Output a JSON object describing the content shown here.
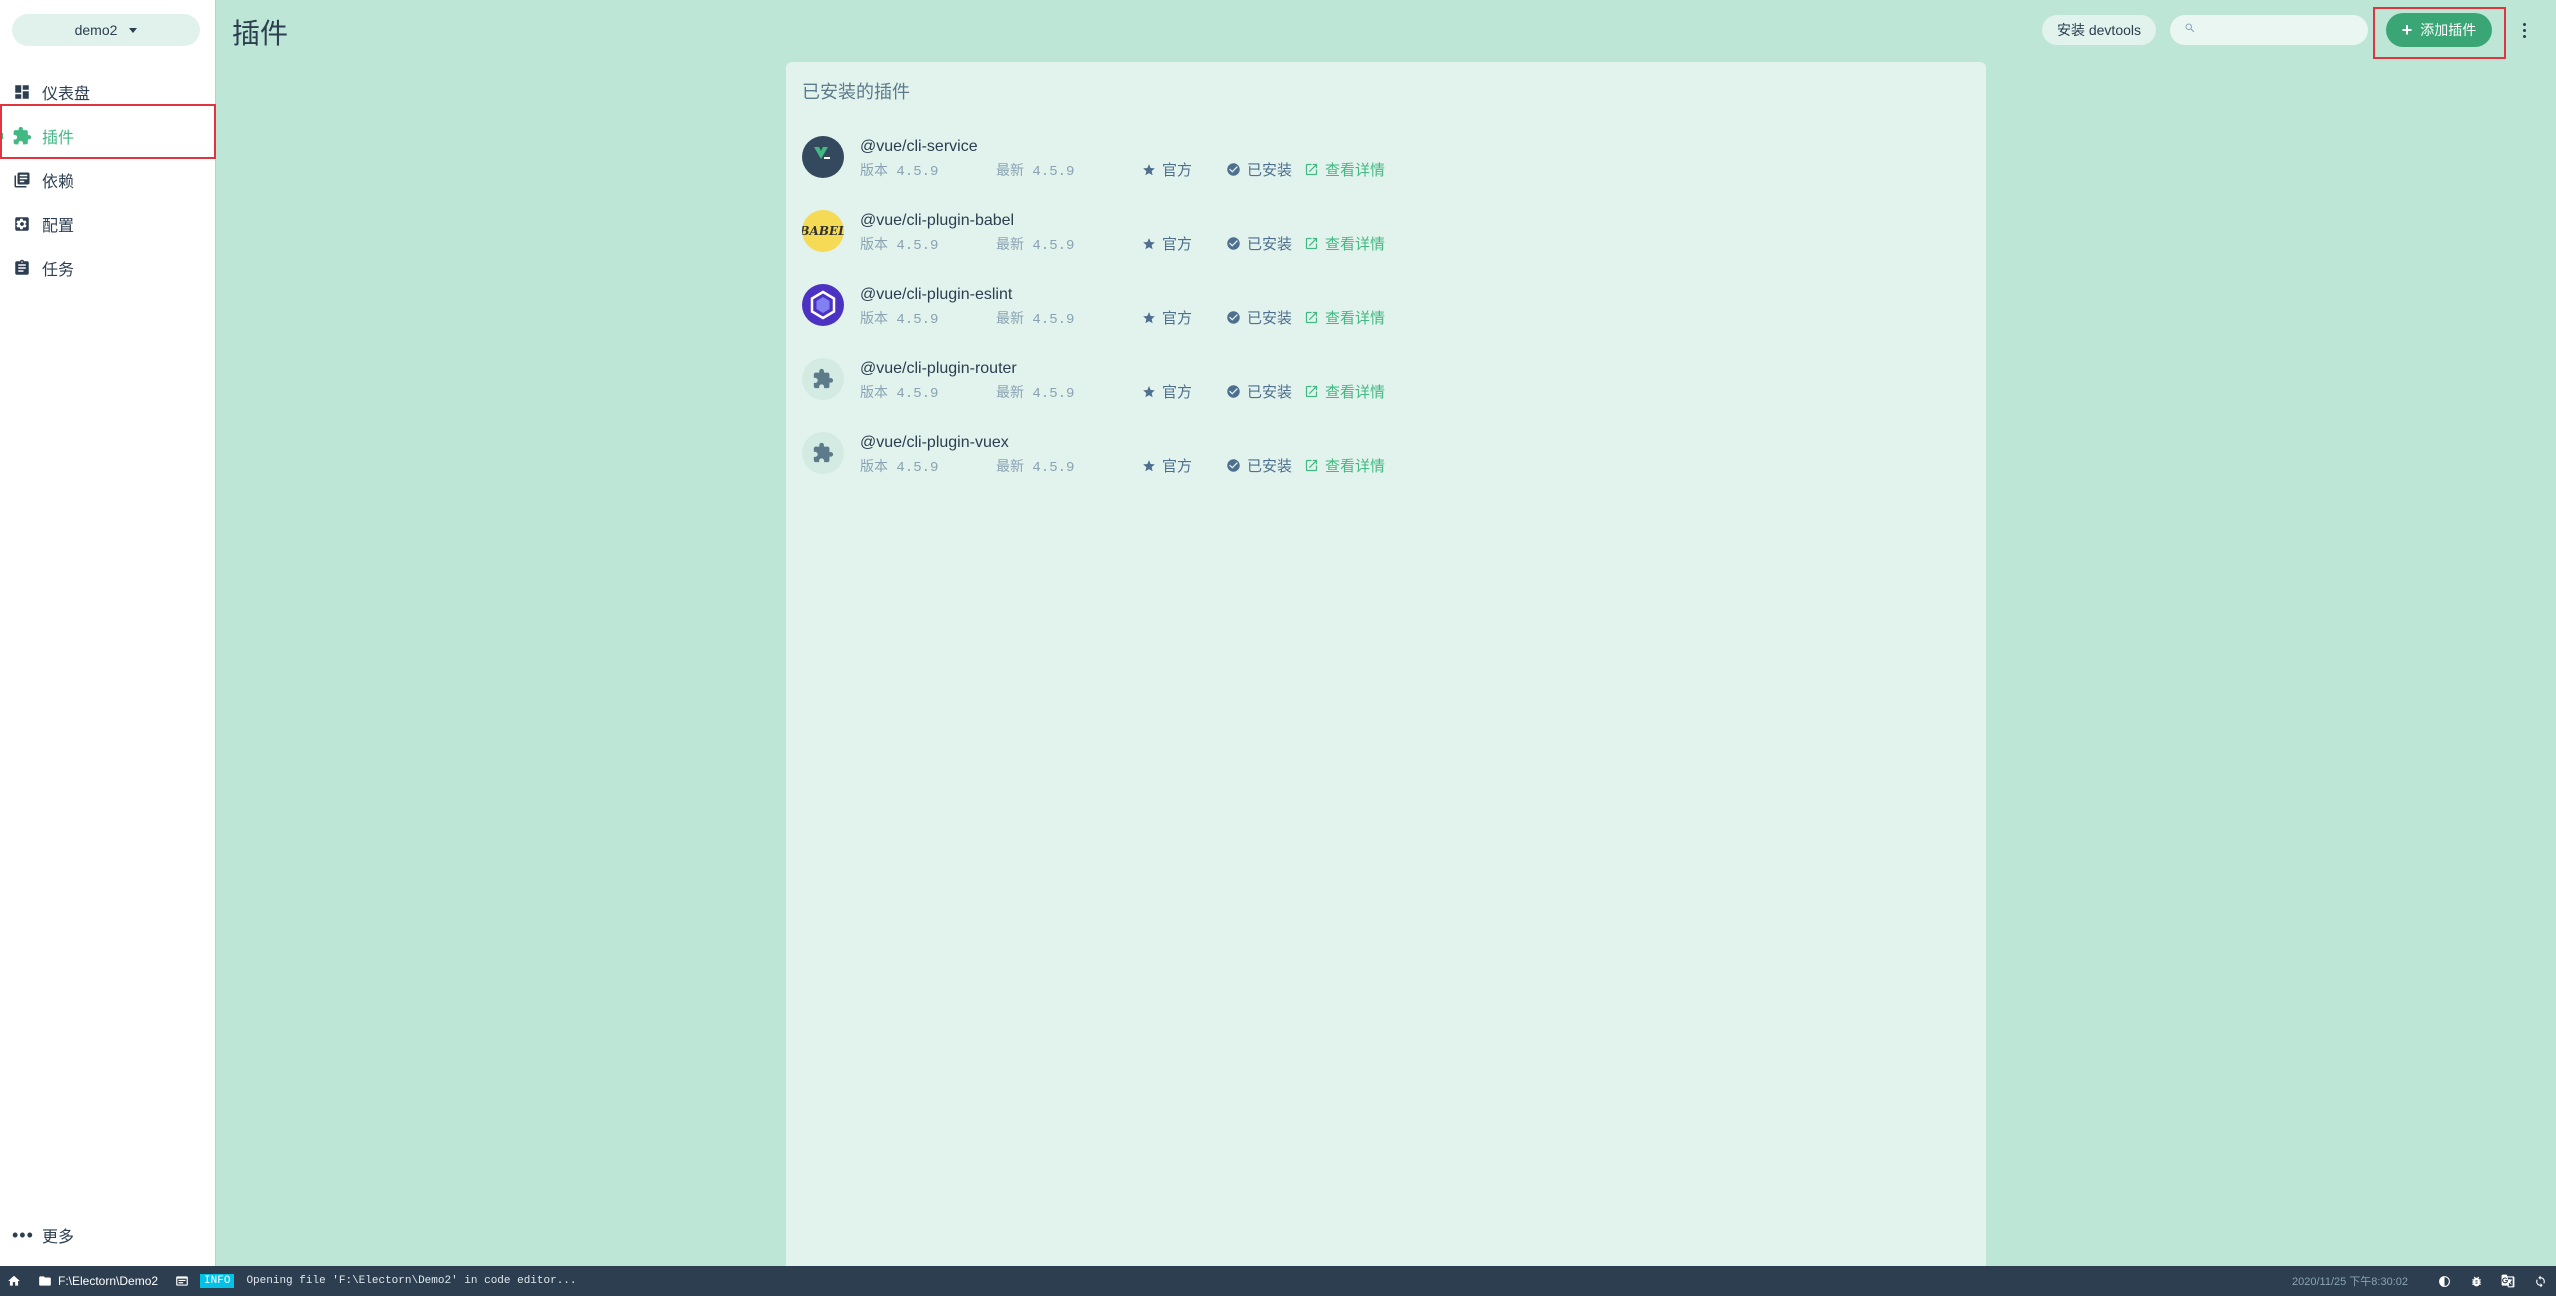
{
  "sidebar": {
    "project": "demo2",
    "items": [
      {
        "label": "仪表盘",
        "icon": "dashboard-icon"
      },
      {
        "label": "插件",
        "icon": "puzzle-icon",
        "active": true
      },
      {
        "label": "依赖",
        "icon": "library-icon"
      },
      {
        "label": "配置",
        "icon": "settings-icon"
      },
      {
        "label": "任务",
        "icon": "clipboard-icon"
      }
    ],
    "more_label": "更多"
  },
  "header": {
    "title": "插件",
    "devtools_label": "安装 devtools",
    "search_placeholder": "",
    "add_plugin_label": "添加插件"
  },
  "panel": {
    "title": "已安装的插件",
    "plugins": [
      {
        "name": "@vue/cli-service",
        "version": "版本 4.5.9",
        "latest": "最新 4.5.9",
        "official": "官方",
        "installed": "已安装",
        "details": "查看详情",
        "icon": "vue-cli-icon"
      },
      {
        "name": "@vue/cli-plugin-babel",
        "version": "版本 4.5.9",
        "latest": "最新 4.5.9",
        "official": "官方",
        "installed": "已安装",
        "details": "查看详情",
        "icon": "babel-icon",
        "logo_text": "BABEL"
      },
      {
        "name": "@vue/cli-plugin-eslint",
        "version": "版本 4.5.9",
        "latest": "最新 4.5.9",
        "official": "官方",
        "installed": "已安装",
        "details": "查看详情",
        "icon": "eslint-icon"
      },
      {
        "name": "@vue/cli-plugin-router",
        "version": "版本 4.5.9",
        "latest": "最新 4.5.9",
        "official": "官方",
        "installed": "已安装",
        "details": "查看详情",
        "icon": "puzzle-icon"
      },
      {
        "name": "@vue/cli-plugin-vuex",
        "version": "版本 4.5.9",
        "latest": "最新 4.5.9",
        "official": "官方",
        "installed": "已安装",
        "details": "查看详情",
        "icon": "puzzle-icon"
      }
    ]
  },
  "statusbar": {
    "path": "F:\\Electorn\\Demo2",
    "log_level": "INFO",
    "message": "Opening file 'F:\\Electorn\\Demo2' in code editor...",
    "time": "2020/11/25 下午8:30:02"
  },
  "colors": {
    "accent": "#42b983",
    "background": "#bde6d7",
    "panel": "#e2f3ed",
    "dark": "#2c3e50",
    "highlight": "#e0353f"
  }
}
